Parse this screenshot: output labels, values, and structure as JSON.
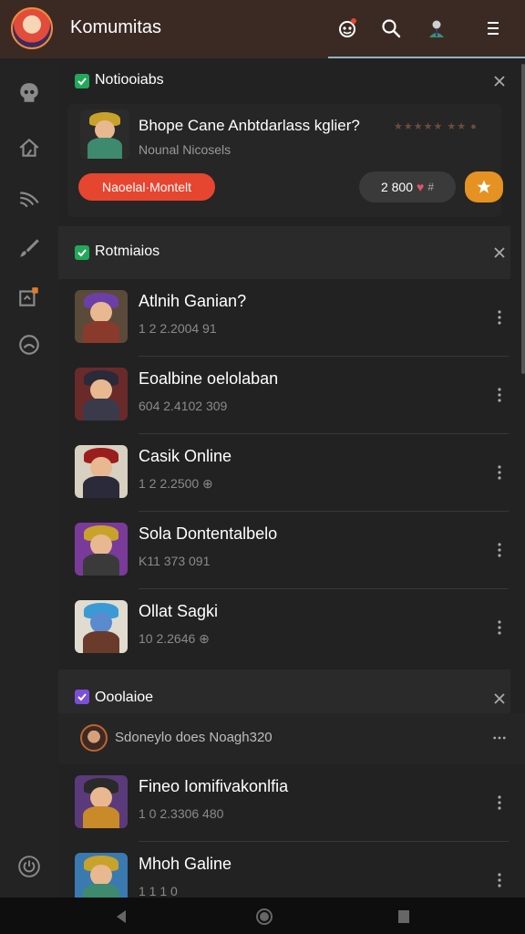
{
  "header": {
    "title": "Komumitas",
    "icons": [
      "robot-notification-icon",
      "search-icon",
      "profile-icon",
      "menu-icon"
    ],
    "accent": "#3b2a24"
  },
  "rail": {
    "items": [
      "skull-icon",
      "home-icon",
      "signal-icon",
      "brush-icon",
      "notification-icon",
      "gamepad-icon"
    ],
    "bottom_icon": "power-icon"
  },
  "sections": {
    "notifications": {
      "title": "Notiooiabs",
      "check_color": "#22a85a",
      "feature": {
        "title": "Bhope Cane Anbtdarlass kglier?",
        "subtitle": "Nounal Nicosels",
        "rating": "★★★★★ ★★ ●",
        "button_label": "Naoelal·Montelt",
        "pill_label": "2 800",
        "button_color": "#e6452f",
        "star_button_color": "#e59223"
      }
    },
    "recommended": {
      "title": "Rotmiaios",
      "check_color": "#22a85a",
      "items": [
        {
          "title": "Atlnih Ganian?",
          "meta": "1 2 2.2004 91"
        },
        {
          "title": "Eoalbine oelolaban",
          "meta": "604 2.4102 309"
        },
        {
          "title": "Casik Online",
          "meta": "1 2 2.2500 ⊕"
        },
        {
          "title": "Sola Dontentalbelo",
          "meta": "K11 373 091"
        },
        {
          "title": "Ollat Sagki",
          "meta": "10 2.2646 ⊕"
        }
      ]
    },
    "discussions": {
      "title": "Ooolaioe",
      "check_color": "#7b4fd6",
      "comment_text": "Sdoneylo does Noagh320",
      "items": [
        {
          "title": "Fineo Iomifivakonlfia",
          "meta": "1 0 2.3306 480"
        },
        {
          "title": "Mhoh Galine",
          "meta": "1 1 1 0"
        }
      ]
    }
  }
}
